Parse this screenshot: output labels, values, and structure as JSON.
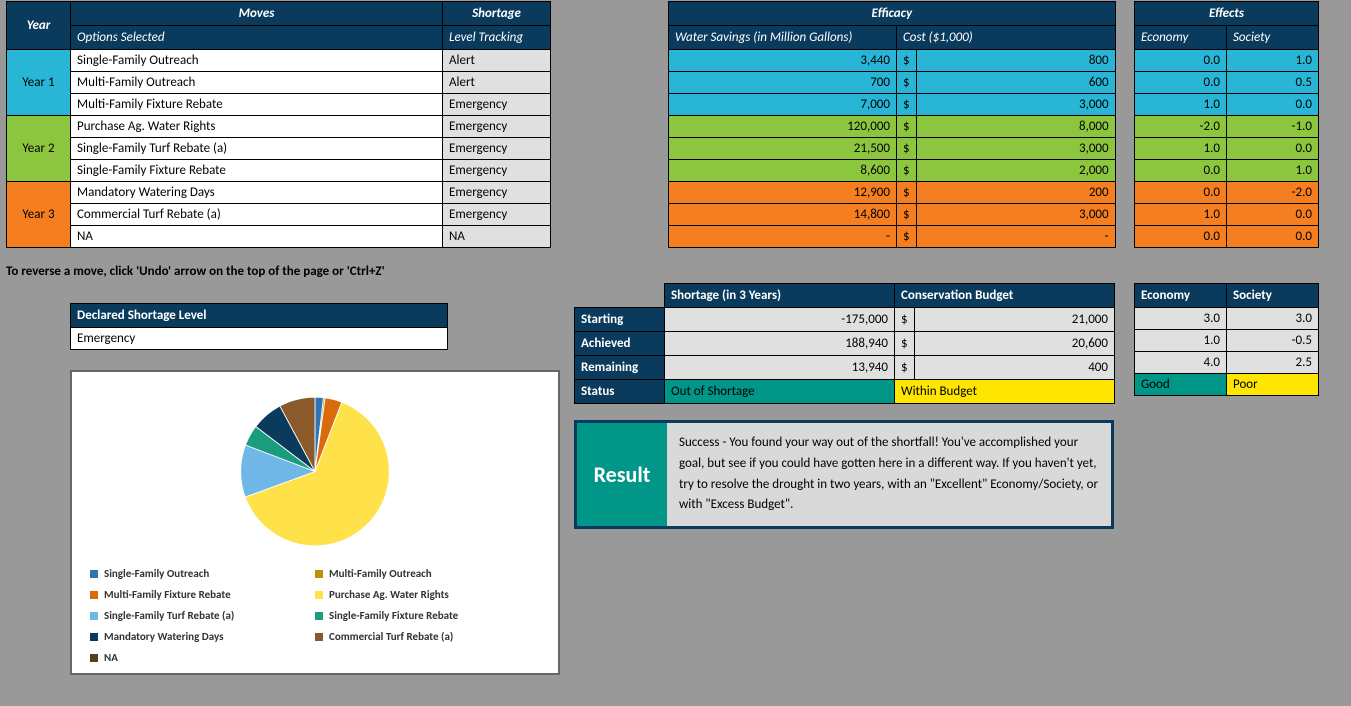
{
  "headers": {
    "year": "Year",
    "moves": "Moves",
    "options_selected": "Options Selected",
    "shortage": "Shortage",
    "level_tracking": "Level Tracking",
    "efficacy": "Efficacy",
    "water_savings": "Water Savings (in Million Gallons)",
    "cost": "Cost ($1,000)",
    "effects": "Effects",
    "economy": "Economy",
    "society": "Society"
  },
  "years": [
    {
      "label": "Year 1",
      "color": "cyan",
      "rows": [
        {
          "option": "Single-Family Outreach",
          "tracking": "Alert",
          "savings": "3,440",
          "cost": "800",
          "econ": "0.0",
          "soc": "1.0"
        },
        {
          "option": "Multi-Family Outreach",
          "tracking": "Alert",
          "savings": "700",
          "cost": "600",
          "econ": "0.0",
          "soc": "0.5"
        },
        {
          "option": "Multi-Family Fixture Rebate",
          "tracking": "Emergency",
          "savings": "7,000",
          "cost": "3,000",
          "econ": "1.0",
          "soc": "0.0"
        }
      ]
    },
    {
      "label": "Year 2",
      "color": "green",
      "rows": [
        {
          "option": "Purchase Ag. Water Rights",
          "tracking": "Emergency",
          "savings": "120,000",
          "cost": "8,000",
          "econ": "-2.0",
          "soc": "-1.0"
        },
        {
          "option": "Single-Family Turf Rebate (a)",
          "tracking": "Emergency",
          "savings": "21,500",
          "cost": "3,000",
          "econ": "1.0",
          "soc": "0.0"
        },
        {
          "option": "Single-Family Fixture Rebate",
          "tracking": "Emergency",
          "savings": "8,600",
          "cost": "2,000",
          "econ": "0.0",
          "soc": "1.0"
        }
      ]
    },
    {
      "label": "Year 3",
      "color": "orange",
      "rows": [
        {
          "option": "Mandatory Watering Days",
          "tracking": "Emergency",
          "savings": "12,900",
          "cost": "200",
          "econ": "0.0",
          "soc": "-2.0"
        },
        {
          "option": "Commercial Turf Rebate (a)",
          "tracking": "Emergency",
          "savings": "14,800",
          "cost": "3,000",
          "econ": "1.0",
          "soc": "0.0"
        },
        {
          "option": "NA",
          "tracking": "NA",
          "savings": "-",
          "cost": "-",
          "econ": "0.0",
          "soc": "0.0"
        }
      ]
    }
  ],
  "undo_note": "To reverse a move, click 'Undo' arrow on the top of the page  or 'Ctrl+Z'",
  "declared_shortage": {
    "label": "Declared Shortage Level",
    "value": "Emergency"
  },
  "summary": {
    "shortage_hdr": "Shortage (in 3 Years)",
    "budget_hdr": "Conservation Budget",
    "rows": {
      "starting": {
        "label": "Starting",
        "shortage": "-175,000",
        "budget": "21,000"
      },
      "achieved": {
        "label": "Achieved",
        "shortage": "188,940",
        "budget": "20,600"
      },
      "remaining": {
        "label": "Remaining",
        "shortage": "13,940",
        "budget": "400"
      }
    },
    "status_label": "Status",
    "status_shortage": "Out of Shortage",
    "status_budget": "Within Budget",
    "dollar": "$"
  },
  "econ_summary": {
    "economy_hdr": "Economy",
    "society_hdr": "Society",
    "starting": {
      "econ": "3.0",
      "soc": "3.0"
    },
    "achieved": {
      "econ": "1.0",
      "soc": "-0.5"
    },
    "remaining": {
      "econ": "4.0",
      "soc": "2.5"
    },
    "status_econ": "Good",
    "status_soc": "Poor"
  },
  "result": {
    "label": "Result",
    "text": "Success - You found your way out of the shortfall! You've accomplished your goal, but see if you could have gotten here in a different way. If you haven't yet, try to resolve the drought in two years, with an \"Excellent\" Economy/Society, or with \"Excess Budget\"."
  },
  "chart_data": {
    "type": "pie",
    "title": "",
    "series": [
      {
        "name": "Single-Family Outreach",
        "value": 3440,
        "color": "#2e75b6"
      },
      {
        "name": "Multi-Family Outreach",
        "value": 700,
        "color": "#bf9000"
      },
      {
        "name": "Multi-Family Fixture Rebate",
        "value": 7000,
        "color": "#d96b0c"
      },
      {
        "name": "Purchase Ag. Water Rights",
        "value": 120000,
        "color": "#ffe24a"
      },
      {
        "name": "Single-Family Turf Rebate (a)",
        "value": 21500,
        "color": "#6fb7e6"
      },
      {
        "name": "Single-Family Fixture Rebate",
        "value": 8600,
        "color": "#1a9c7f"
      },
      {
        "name": "Mandatory Watering Days",
        "value": 12900,
        "color": "#0a3a5c"
      },
      {
        "name": "Commercial Turf Rebate (a)",
        "value": 14800,
        "color": "#8b5a2b"
      },
      {
        "name": "NA",
        "value": 0,
        "color": "#5b3d1e"
      }
    ]
  }
}
